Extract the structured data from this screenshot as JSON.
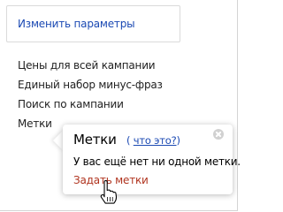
{
  "change_params_label": "Изменить параметры",
  "links": [
    "Цены для всей кампании",
    "Единый набор минус-фраз",
    "Поиск по кампании",
    "Метки"
  ],
  "popup": {
    "title": "Метки",
    "help_open": "(",
    "help_link": "что это?",
    "help_close": ")",
    "message": "У вас ещё нет ни одной метки.",
    "action_label": "Задать метки",
    "close_icon": "close-circle-icon"
  },
  "cursor_icon": "hand-pointer-icon",
  "colors": {
    "link_blue": "#1b49b3",
    "action_red": "#b0341f",
    "text": "#222222"
  }
}
